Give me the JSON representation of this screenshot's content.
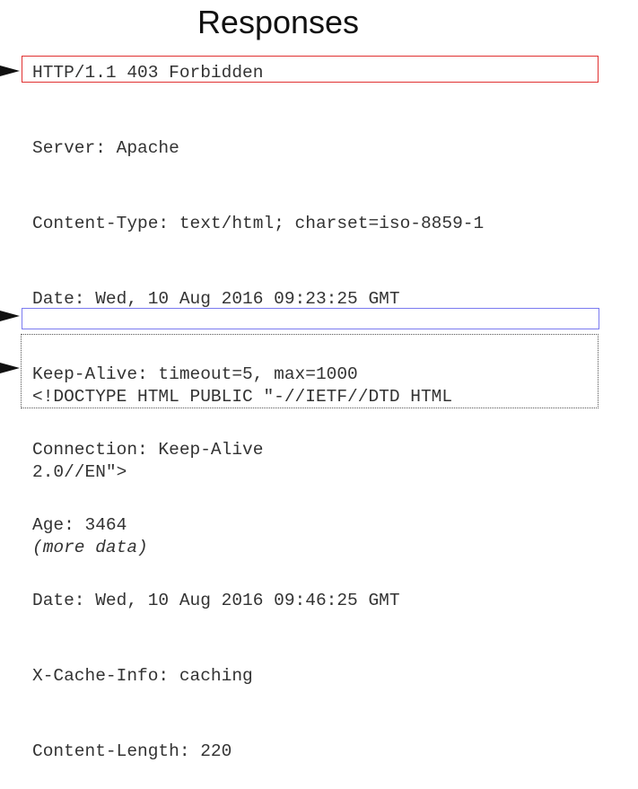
{
  "title": "Responses",
  "status_line": "HTTP/1.1 403 Forbidden",
  "headers": [
    "Server: Apache",
    "Content-Type: text/html; charset=iso-8859-1",
    "Date: Wed, 10 Aug 2016 09:23:25 GMT",
    "Keep-Alive: timeout=5, max=1000",
    "Connection: Keep-Alive",
    "Age: 3464",
    "Date: Wed, 10 Aug 2016 09:46:25 GMT",
    "X-Cache-Info: caching",
    "Content-Length: 220"
  ],
  "body": {
    "line1": "<!DOCTYPE HTML PUBLIC \"-//IETF//DTD HTML",
    "line2": "2.0//EN\">",
    "note": "(more data)"
  },
  "colors": {
    "status_box": "#e03131",
    "blank_line_box": "#7b7bf0",
    "body_box": "#555555"
  }
}
